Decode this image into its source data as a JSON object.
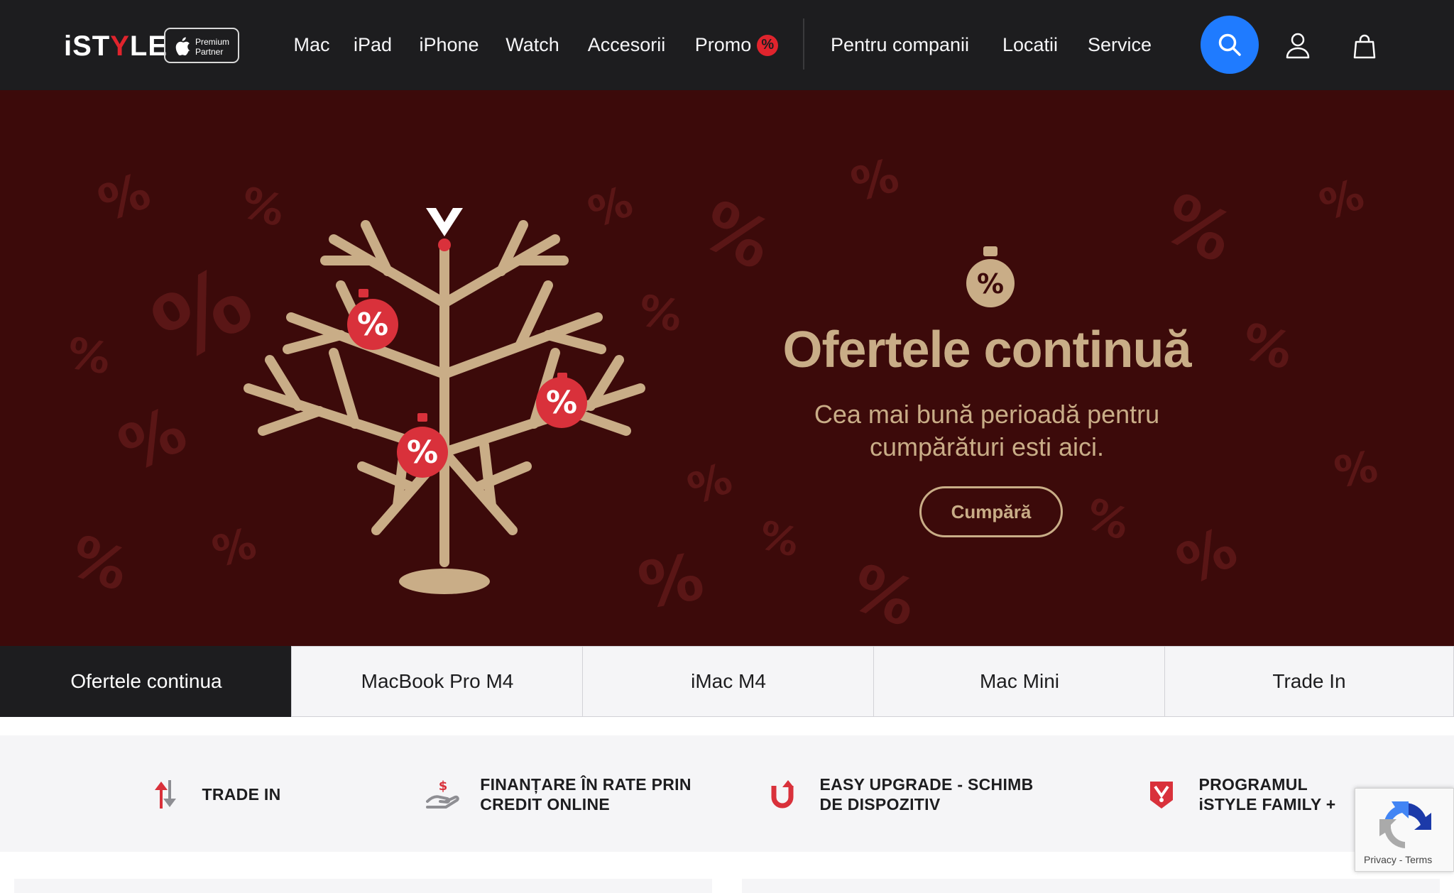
{
  "brand": {
    "logo_prefix": "iST",
    "logo_mark": "Y",
    "logo_suffix": "LE",
    "partner_line1": "Premium",
    "partner_line2": "Partner"
  },
  "nav": {
    "items": [
      {
        "label": "Mac"
      },
      {
        "label": "iPad"
      },
      {
        "label": "iPhone"
      },
      {
        "label": "Watch"
      },
      {
        "label": "Accesorii"
      },
      {
        "label": "Promo",
        "badge": "%"
      },
      {
        "label": "Pentru companii"
      },
      {
        "label": "Locatii"
      },
      {
        "label": "Service"
      }
    ],
    "icons": {
      "search": "search-icon",
      "account": "user-icon",
      "cart": "shopping-bag-icon"
    }
  },
  "hero": {
    "ornament_symbol": "%",
    "title": "Ofertele continuă",
    "subtitle_line1": "Cea mai bună perioadă pentru",
    "subtitle_line2": "cumpărături esti aici.",
    "cta": "Cumpără",
    "background_symbol": "%",
    "colors": {
      "background": "#3c0a0a",
      "accent": "#c9ad87",
      "ornament": "#d9313b"
    }
  },
  "tabs": [
    {
      "label": "Ofertele continua",
      "active": true
    },
    {
      "label": "MacBook Pro M4",
      "active": false
    },
    {
      "label": "iMac M4",
      "active": false
    },
    {
      "label": "Mac Mini",
      "active": false
    },
    {
      "label": "Trade In",
      "active": false
    }
  ],
  "features": [
    {
      "line1": "TRADE IN",
      "line2": "",
      "icon": "trade-in-arrows-icon"
    },
    {
      "line1": "FINANȚARE ÎN RATE PRIN",
      "line2": "CREDIT ONLINE",
      "icon": "hand-money-icon"
    },
    {
      "line1": "EASY UPGRADE - SCHIMB",
      "line2": "DE DISPOZITIV",
      "icon": "upgrade-u-icon"
    },
    {
      "line1": "PROGRAMUL",
      "line2": "iSTYLE FAMILY +",
      "icon": "istyle-family-badge-icon"
    }
  ],
  "recaptcha": {
    "privacy": "Privacy",
    "separator": " - ",
    "terms": "Terms"
  },
  "colors": {
    "topbar": "#1d1d1f",
    "search_button": "#1f7bff",
    "brand_red": "#e0242d"
  }
}
